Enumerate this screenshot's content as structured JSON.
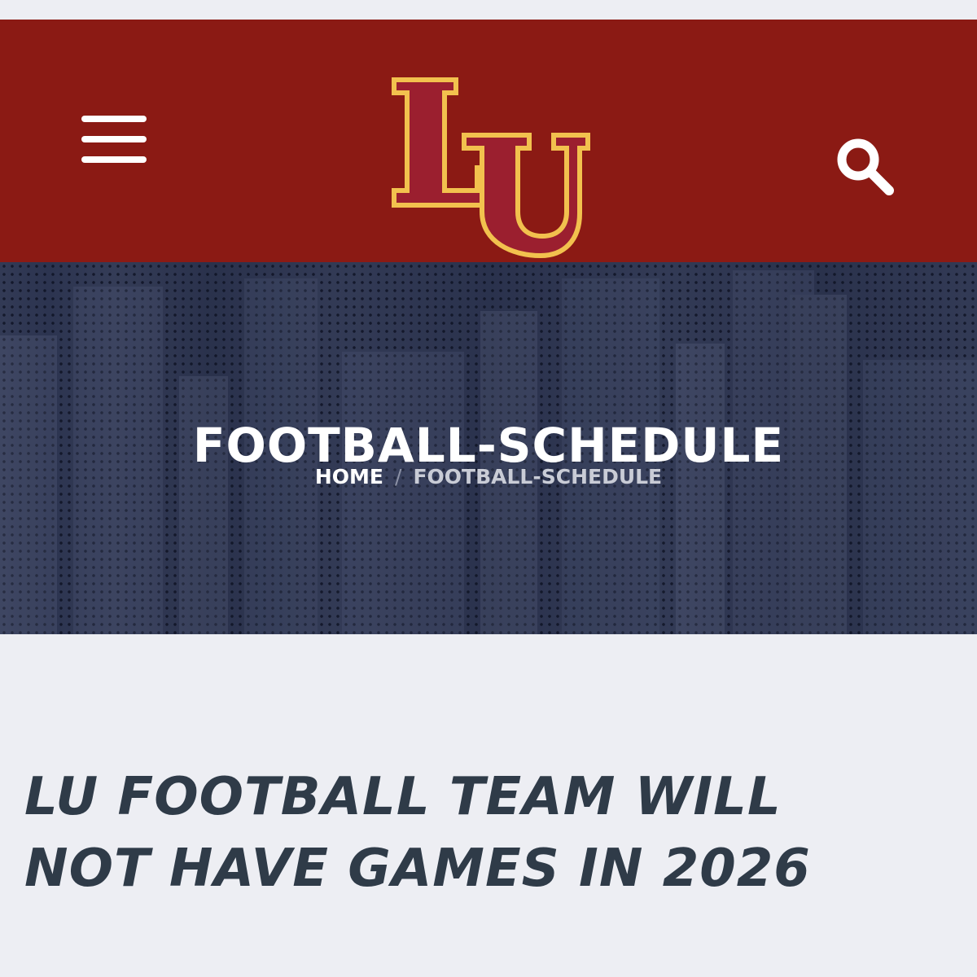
{
  "header": {
    "logo_text": "LU",
    "colors": {
      "bar": "#8b1a14",
      "logo_fill": "#9b1f2f",
      "logo_outline": "#f2c14e"
    },
    "icons": {
      "menu": "hamburger-icon",
      "search": "search-icon"
    }
  },
  "hero": {
    "title": "FOOTBALL-SCHEDULE",
    "breadcrumb": {
      "home": "HOME",
      "separator": "/",
      "current": "FOOTBALL-SCHEDULE"
    },
    "background_color": "#2c3450"
  },
  "article": {
    "headline_line1": "LU FOOTBALL TEAM WILL",
    "headline_line2": "NOT HAVE GAMES IN 2026",
    "color": "#2f3b48"
  }
}
